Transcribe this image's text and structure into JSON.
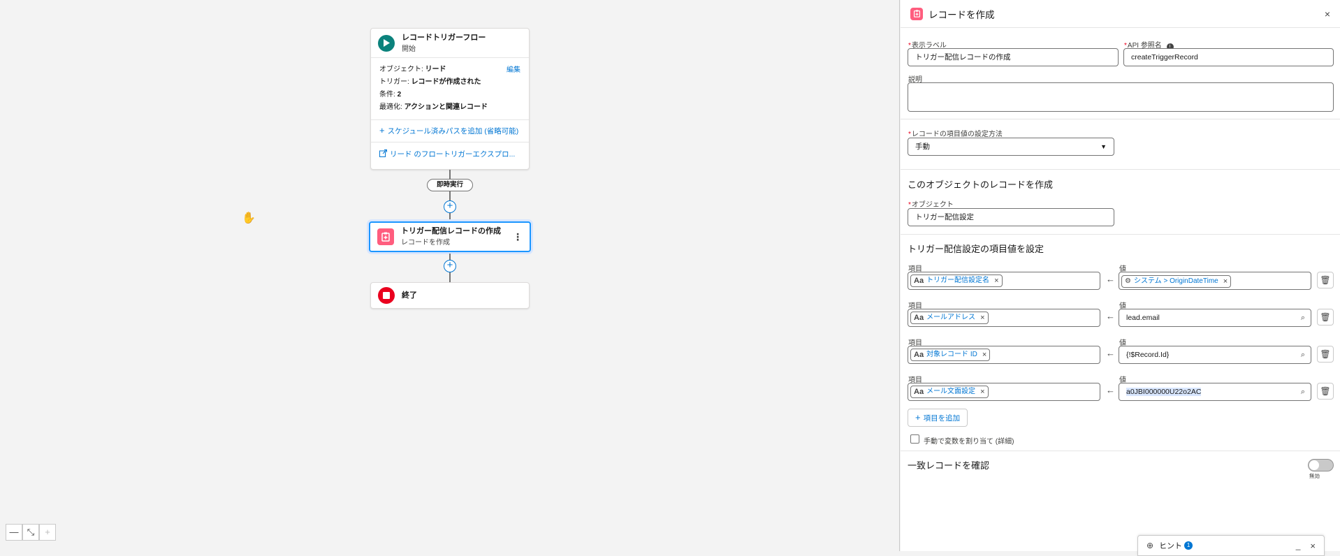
{
  "canvas": {
    "start_node": {
      "title": "レコードトリガーフロー",
      "subtitle": "開始",
      "object_label": "オブジェクト:",
      "object_value": "リード",
      "edit_link": "編集",
      "trigger_label": "トリガー:",
      "trigger_value": "レコードが作成された",
      "conditions_label": "条件:",
      "conditions_value": "2",
      "optimize_label": "最適化:",
      "optimize_value": "アクションと関連レコード",
      "add_scheduled_path": "スケジュール済みパスを追加 (省略可能)",
      "explorer_link": "リード のフロートリガーエクスプロ..."
    },
    "path_pill": "即時実行",
    "action_node": {
      "title": "トリガー配信レコードの作成",
      "subtitle": "レコードを作成"
    },
    "end_node": {
      "title": "終了"
    },
    "zoom": {
      "zoom_out": "—",
      "fit": "⤡",
      "zoom_in": "+"
    }
  },
  "panel": {
    "title": "レコードを作成",
    "close": "×",
    "label_field": {
      "label": "表示ラベル",
      "value": "トリガー配信レコードの作成"
    },
    "api_field": {
      "label": "API 参照名",
      "value": "createTriggerRecord"
    },
    "description": {
      "label": "説明",
      "value": ""
    },
    "set_values_method": {
      "label": "レコードの項目値の設定方法",
      "value": "手動"
    },
    "section_create_title": "このオブジェクトのレコードを作成",
    "object_field": {
      "label": "オブジェクト",
      "value": "トリガー配信設定"
    },
    "section_set_title": "トリガー配信設定の項目値を設定",
    "field_label": "項目",
    "value_label": "値",
    "rows": [
      {
        "field": "トリガー配信設定名",
        "value_chip": "システム > OriginDateTime",
        "value_text": ""
      },
      {
        "field": "メールアドレス",
        "value_chip": "",
        "value_text": "lead.email"
      },
      {
        "field": "対象レコード ID",
        "value_chip": "",
        "value_text": "{!$Record.Id}"
      },
      {
        "field": "メール文面設定",
        "value_chip": "",
        "value_text": "a0JBI000000U22o2AC"
      }
    ],
    "add_field_button": "項目を追加",
    "manual_assign_checkbox": "手動で変数を割り当て (詳細)",
    "match_section_title": "一致レコードを確認",
    "toggle_label": "無効",
    "hint": {
      "label": "ヒント",
      "count": "1"
    }
  }
}
